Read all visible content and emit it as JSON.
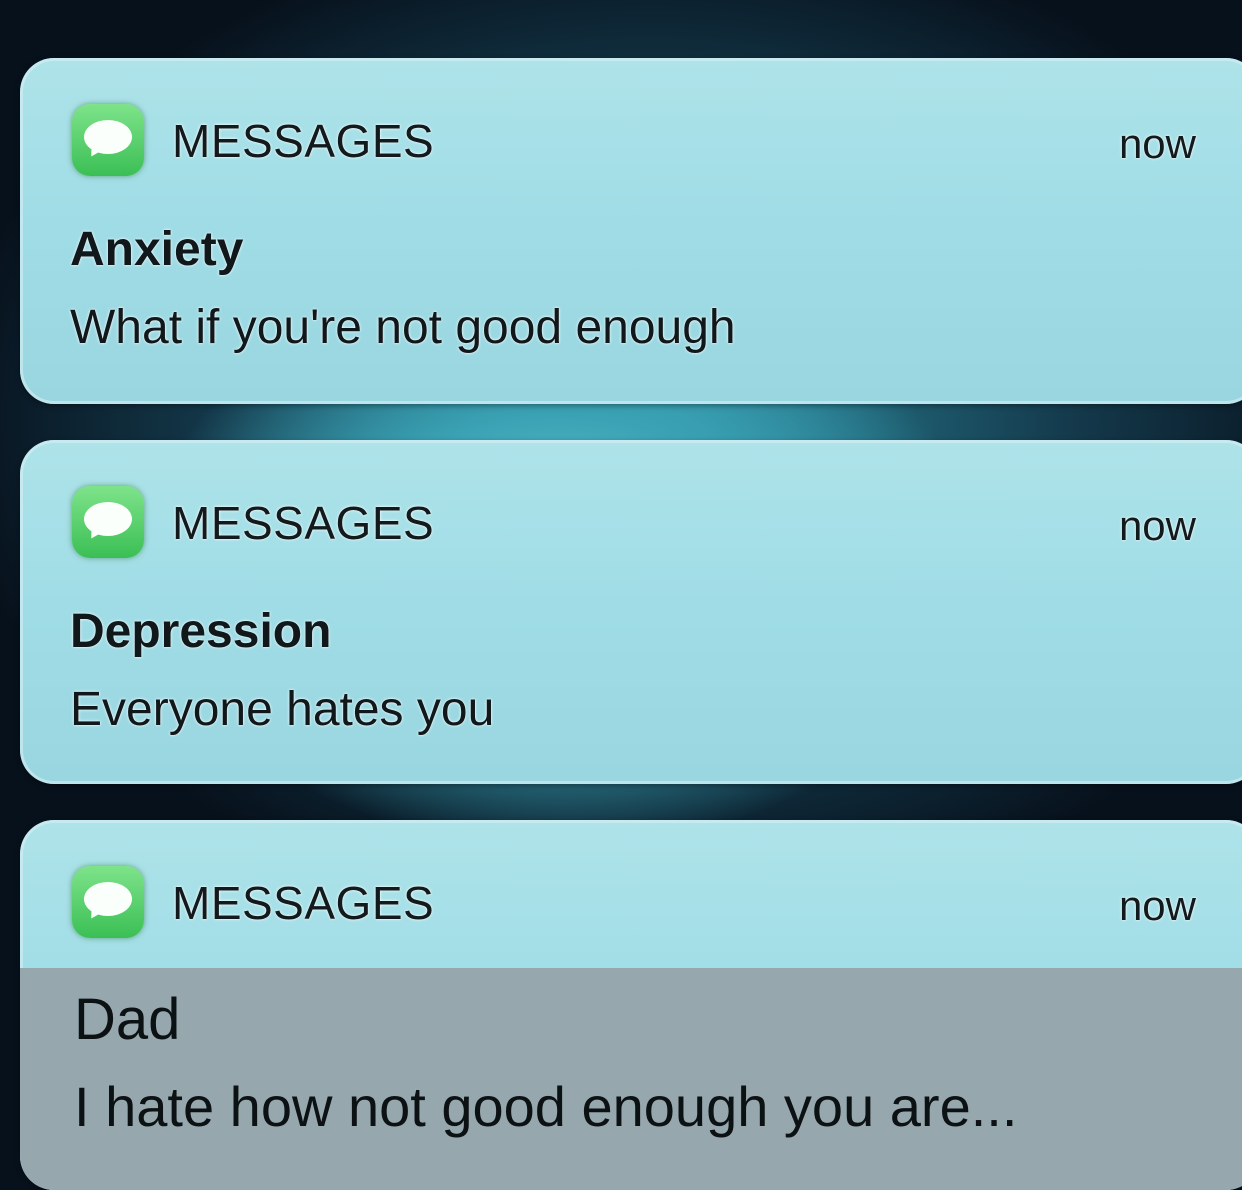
{
  "notifications": [
    {
      "app_icon": "messages-icon",
      "app_name": "MESSAGES",
      "time": "now",
      "sender": "Anxiety",
      "message": "What if you're not good enough"
    },
    {
      "app_icon": "messages-icon",
      "app_name": "MESSAGES",
      "time": "now",
      "sender": "Depression",
      "message": "Everyone hates you"
    },
    {
      "app_icon": "messages-icon",
      "app_name": "MESSAGES",
      "time": "now",
      "sender": "Dad",
      "message": "I hate how not good enough you are..."
    }
  ],
  "colors": {
    "card": "#aee3e9",
    "icon_green": "#3bbf55",
    "overlay_grey": "#96a8ad",
    "text": "#10181b"
  }
}
